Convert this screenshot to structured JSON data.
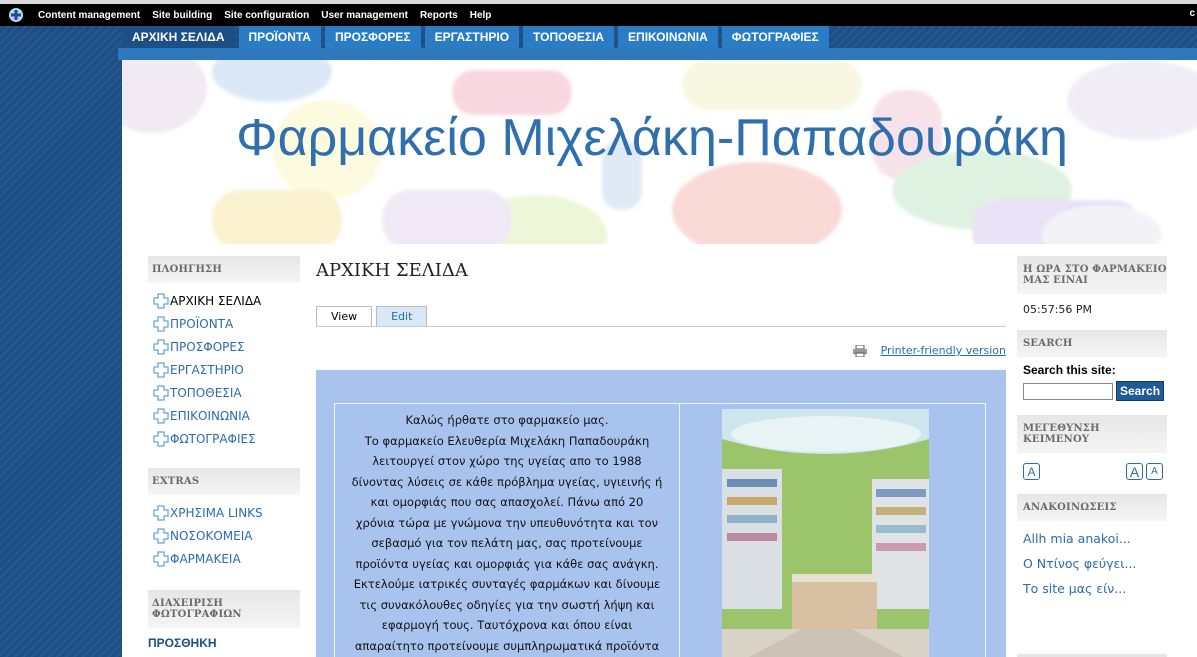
{
  "admin_bar": {
    "items": [
      "Content management",
      "Site building",
      "Site configuration",
      "User management",
      "Reports",
      "Help"
    ],
    "right_text": "c"
  },
  "primary_nav": {
    "items": [
      "ΑΡΧΙΚΗ ΣΕΛΙΔΑ",
      "ΠΡΟΪΟΝΤΑ",
      "ΠΡΟΣΦΟΡΕΣ",
      "ΕΡΓΑΣΤΗΡΙΟ",
      "ΤΟΠΟΘΕΣΙΑ",
      "ΕΠΙΚΟΙΝΩΝΙΑ",
      "ΦΩΤΟΓΡΑΦΙΕΣ"
    ],
    "active_index": 0
  },
  "site": {
    "title": "Φαρμακείο Μιχελάκη-Παπαδουράκη"
  },
  "left_sidebar": {
    "navigation": {
      "title": "ΠΛΟΗΓΗΣΗ",
      "items": [
        "ΑΡΧΙΚΗ ΣΕΛΙΔΑ",
        "ΠΡΟΪΟΝΤΑ",
        "ΠΡΟΣΦΟΡΕΣ",
        "ΕΡΓΑΣΤΗΡΙΟ",
        "ΤΟΠΟΘΕΣΙΑ",
        "ΕΠΙΚΟΙΝΩΝΙΑ",
        "ΦΩΤΟΓΡΑΦΙΕΣ"
      ]
    },
    "extras": {
      "title": "EXTRAS",
      "items": [
        "ΧΡΗΣΙΜΑ LINKS",
        "ΝΟΣΟΚΟΜΕΙΑ",
        "ΦΑΡΜΑΚΕΙΑ"
      ]
    },
    "photo_admin": {
      "title": "ΔΙΑΧΕΙΡΙΣΗ ΦΩΤΟΓΡΑΦΙΩΝ",
      "link": "ΠΡΟΣΘΗΚΗ"
    }
  },
  "main": {
    "heading": "ΑΡΧΙΚΗ ΣΕΛΙΔΑ",
    "tabs": [
      "View",
      "Edit"
    ],
    "printer_link": "Printer-friendly version",
    "article_lines": [
      "Καλώς ήρθατε στο φαρμακείο μας.",
      "Το φαρμακείο Ελευθερία Μιχελάκη Παπαδουράκη",
      "λειτουργεί στον χώρο της υγείας απο το 1988",
      "δίνοντας λύσεις σε κάθε πρόβλημα υγείας, υγιεινής ή",
      "και ομορφιάς που σας απασχολεί. Πάνω από 20",
      "χρόνια τώρα με γνώμονα την υπευθυνότητα και τον",
      "σεβασμό για τον πελάτη μας, σας προτείνουμε",
      "προϊόντα υγείας και ομορφιάς για κάθε σας ανάγκη.",
      "Εκτελούμε ιατρικές συνταγές φαρμάκων και δίνουμε",
      "τις συνακόλουθες οδηγίες για την σωστή λήψη και",
      "εφαρμογή τους. Ταυτόχρονα και όπου είναι",
      "απαραίτητο προτείνουμε συμπληρωματικά προϊόντα"
    ]
  },
  "right_sidebar": {
    "clock": {
      "title": "Η ΩΡΑ ΣΤΟ ΦΑΡΜΑΚΕΙΟ ΜΑΣ ΕΙΝΑΙ",
      "time": "05:57:56 PM"
    },
    "search": {
      "title": "SEARCH",
      "label": "Search this site:",
      "value": "",
      "button": "Search"
    },
    "text_resize": {
      "title": "ΜΕΓΕΘΥΝΣΗ ΚΕΙΜΕΝΟΥ",
      "buttons": [
        "A",
        "A",
        "A"
      ]
    },
    "announcements": {
      "title": "ΑΝΑΚΟΙΝΩΣΕΙΣ",
      "items": [
        "Allh mia anakoi...",
        "Ο Ντίνος φεύγει...",
        "Το site μας είν..."
      ]
    }
  },
  "colors": {
    "brand_blue": "#2a7dc4",
    "dark_blue": "#1b4f86",
    "title_blue": "#2f6fae",
    "article_bg": "#a9c3ef"
  }
}
